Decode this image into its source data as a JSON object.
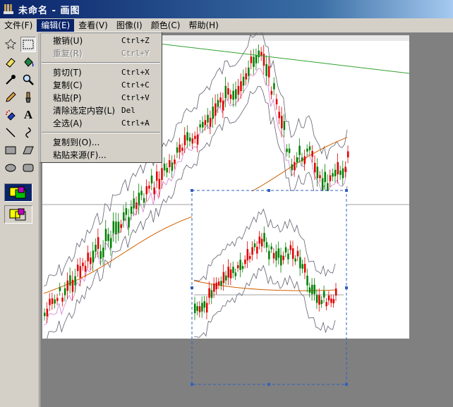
{
  "window": {
    "title": "未命名 - 画图"
  },
  "menubar": {
    "items": [
      {
        "label": "文件(F)"
      },
      {
        "label": "编辑(E)"
      },
      {
        "label": "查看(V)"
      },
      {
        "label": "图像(I)"
      },
      {
        "label": "颜色(C)"
      },
      {
        "label": "帮助(H)"
      }
    ],
    "active_index": 1
  },
  "edit_menu": {
    "items": [
      {
        "label": "撤销(U)",
        "shortcut": "Ctrl+Z",
        "enabled": true
      },
      {
        "label": "重复(R)",
        "shortcut": "Ctrl+Y",
        "enabled": false
      },
      {
        "label": "剪切(T)",
        "shortcut": "Ctrl+X",
        "enabled": true
      },
      {
        "label": "复制(C)",
        "shortcut": "Ctrl+C",
        "enabled": true
      },
      {
        "label": "粘贴(P)",
        "shortcut": "Ctrl+V",
        "enabled": true
      },
      {
        "label": "清除选定内容(L)",
        "shortcut": "Del",
        "enabled": true
      },
      {
        "label": "全选(A)",
        "shortcut": "Ctrl+A",
        "enabled": true
      },
      {
        "label": "复制到(O)...",
        "shortcut": "",
        "enabled": true
      },
      {
        "label": "粘贴来源(F)...",
        "shortcut": "",
        "enabled": true
      }
    ]
  },
  "toolbox": {
    "tools": [
      {
        "icon": "free-select-icon"
      },
      {
        "icon": "rect-select-icon"
      },
      {
        "icon": "eraser-icon"
      },
      {
        "icon": "fill-bucket-icon"
      },
      {
        "icon": "color-picker-icon"
      },
      {
        "icon": "magnifier-icon"
      },
      {
        "icon": "pencil-icon"
      },
      {
        "icon": "brush-icon"
      },
      {
        "icon": "airbrush-icon"
      },
      {
        "icon": "text-icon"
      },
      {
        "icon": "line-icon"
      },
      {
        "icon": "curve-icon"
      },
      {
        "icon": "rectangle-icon"
      },
      {
        "icon": "polygon-icon"
      },
      {
        "icon": "ellipse-icon"
      },
      {
        "icon": "rounded-rect-icon"
      }
    ],
    "selected_tool": "rect-select-icon",
    "text_tool_glyph": "A"
  },
  "colors": {
    "title_start": "#0a246a",
    "title_end": "#a6caf0",
    "menu_highlight": "#0a246a",
    "workspace": "#808080",
    "canvas": "#ffffff",
    "candle_up": "#008000",
    "candle_down": "#e00000",
    "selection": "#3060c0"
  }
}
